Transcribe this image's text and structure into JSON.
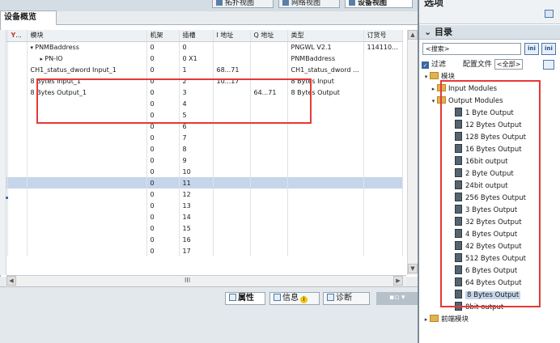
{
  "view_tabs": [
    {
      "label": "拓扑视图",
      "active": false
    },
    {
      "label": "网络视图",
      "active": false
    },
    {
      "label": "设备视图",
      "active": true
    }
  ],
  "overview": {
    "tab_label": "设备概览",
    "columns": [
      "",
      "...",
      "模块",
      "机架",
      "插槽",
      "I 地址",
      "Q 地址",
      "类型",
      "订货号"
    ],
    "rows": [
      {
        "name": "PNMBaddress",
        "rack": "0",
        "slot": "0",
        "i": "",
        "q": "",
        "type": "PNGWL V2.1",
        "order": "114110..."
      },
      {
        "name": "PN-IO",
        "rack": "0",
        "slot": "0 X1",
        "i": "",
        "q": "",
        "type": "PNMBaddress",
        "order": ""
      },
      {
        "name": "CH1_status_dword Input_1",
        "rack": "0",
        "slot": "1",
        "i": "68...71",
        "q": "",
        "type": "CH1_status_dword ...",
        "order": ""
      },
      {
        "name": "8 Bytes Input_1",
        "rack": "0",
        "slot": "2",
        "i": "10...17",
        "q": "",
        "type": "8 Bytes Input",
        "order": ""
      },
      {
        "name": "8 Bytes Output_1",
        "rack": "0",
        "slot": "3",
        "i": "",
        "q": "64...71",
        "type": "8 Bytes Output",
        "order": ""
      },
      {
        "name": "",
        "rack": "0",
        "slot": "4",
        "i": "",
        "q": "",
        "type": "",
        "order": ""
      },
      {
        "name": "",
        "rack": "0",
        "slot": "5",
        "i": "",
        "q": "",
        "type": "",
        "order": ""
      },
      {
        "name": "",
        "rack": "0",
        "slot": "6",
        "i": "",
        "q": "",
        "type": "",
        "order": ""
      },
      {
        "name": "",
        "rack": "0",
        "slot": "7",
        "i": "",
        "q": "",
        "type": "",
        "order": ""
      },
      {
        "name": "",
        "rack": "0",
        "slot": "8",
        "i": "",
        "q": "",
        "type": "",
        "order": ""
      },
      {
        "name": "",
        "rack": "0",
        "slot": "9",
        "i": "",
        "q": "",
        "type": "",
        "order": ""
      },
      {
        "name": "",
        "rack": "0",
        "slot": "10",
        "i": "",
        "q": "",
        "type": "",
        "order": ""
      },
      {
        "name": "",
        "rack": "0",
        "slot": "11",
        "i": "",
        "q": "",
        "type": "",
        "order": ""
      },
      {
        "name": "",
        "rack": "0",
        "slot": "12",
        "i": "",
        "q": "",
        "type": "",
        "order": ""
      },
      {
        "name": "",
        "rack": "0",
        "slot": "13",
        "i": "",
        "q": "",
        "type": "",
        "order": ""
      },
      {
        "name": "",
        "rack": "0",
        "slot": "14",
        "i": "",
        "q": "",
        "type": "",
        "order": ""
      },
      {
        "name": "",
        "rack": "0",
        "slot": "15",
        "i": "",
        "q": "",
        "type": "",
        "order": ""
      },
      {
        "name": "",
        "rack": "0",
        "slot": "16",
        "i": "",
        "q": "",
        "type": "",
        "order": ""
      },
      {
        "name": "",
        "rack": "0",
        "slot": "17",
        "i": "",
        "q": "",
        "type": "",
        "order": ""
      }
    ],
    "hscroll_thumb": "III"
  },
  "bottom_tabs": [
    {
      "label": "属性",
      "active": true
    },
    {
      "label": "信息",
      "badge": "i",
      "active": false
    },
    {
      "label": "诊断",
      "active": false
    }
  ],
  "right_panel": {
    "title": "选项",
    "catalog_header": "目录",
    "search_placeholder": "<搜索>",
    "search_btn1": "ini",
    "search_btn2": "ini",
    "filter_label": "过滤",
    "config_label": "配置文件",
    "config_value": "<全部>",
    "tree": {
      "root": "模块",
      "input_modules": "Input Modules",
      "output_modules": "Output Modules",
      "items": [
        "1 Byte Output",
        "12 Bytes Output",
        "128 Bytes Output",
        "16 Bytes Output",
        "16bit output",
        "2 Byte Output",
        "24bit output",
        "256 Bytes Output",
        "3 Bytes Output",
        "32 Bytes Output",
        "4 Bytes Output",
        "42 Bytes Output",
        "512 Bytes Output",
        "6 Bytes Output",
        "64 Bytes Output",
        "8 Bytes Output",
        "8bit output"
      ],
      "front_modules": "前端模块"
    }
  },
  "highlight_color": "#e53935"
}
